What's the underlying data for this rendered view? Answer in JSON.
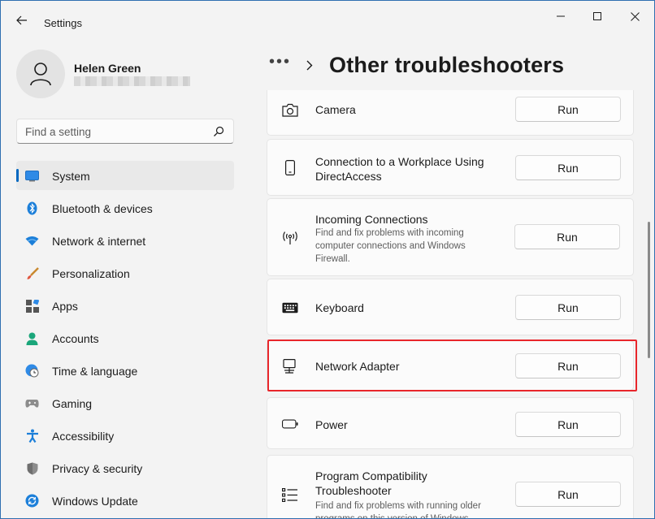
{
  "window": {
    "title": "Settings"
  },
  "profile": {
    "name": "Helen Green"
  },
  "search": {
    "placeholder": "Find a setting"
  },
  "nav": {
    "items": [
      {
        "label": "System",
        "icon": "monitor-icon",
        "active": true
      },
      {
        "label": "Bluetooth & devices",
        "icon": "bluetooth-icon"
      },
      {
        "label": "Network & internet",
        "icon": "wifi-icon"
      },
      {
        "label": "Personalization",
        "icon": "brush-icon"
      },
      {
        "label": "Apps",
        "icon": "apps-icon"
      },
      {
        "label": "Accounts",
        "icon": "person-icon"
      },
      {
        "label": "Time & language",
        "icon": "globe-clock-icon"
      },
      {
        "label": "Gaming",
        "icon": "gamepad-icon"
      },
      {
        "label": "Accessibility",
        "icon": "accessibility-icon"
      },
      {
        "label": "Privacy & security",
        "icon": "shield-icon"
      },
      {
        "label": "Windows Update",
        "icon": "update-icon"
      }
    ]
  },
  "breadcrumb": {
    "more": "•••",
    "title": "Other troubleshooters"
  },
  "troubleshooters": [
    {
      "title": "Camera",
      "icon": "camera-icon",
      "button": "Run"
    },
    {
      "title": "Connection to a Workplace Using DirectAccess",
      "icon": "phone-device-icon",
      "button": "Run"
    },
    {
      "title": "Incoming Connections",
      "description": "Find and fix problems with incoming computer connections and Windows Firewall.",
      "icon": "broadcast-icon",
      "button": "Run"
    },
    {
      "title": "Keyboard",
      "icon": "keyboard-icon",
      "button": "Run"
    },
    {
      "title": "Network Adapter",
      "icon": "network-adapter-icon",
      "button": "Run",
      "highlighted": true
    },
    {
      "title": "Power",
      "icon": "battery-icon",
      "button": "Run"
    },
    {
      "title": "Program Compatibility Troubleshooter",
      "description": "Find and fix problems with running older programs on this version of Windows.",
      "icon": "list-icon",
      "button": "Run"
    }
  ],
  "colors": {
    "accent": "#0067c0",
    "highlight": "#e8262b"
  }
}
